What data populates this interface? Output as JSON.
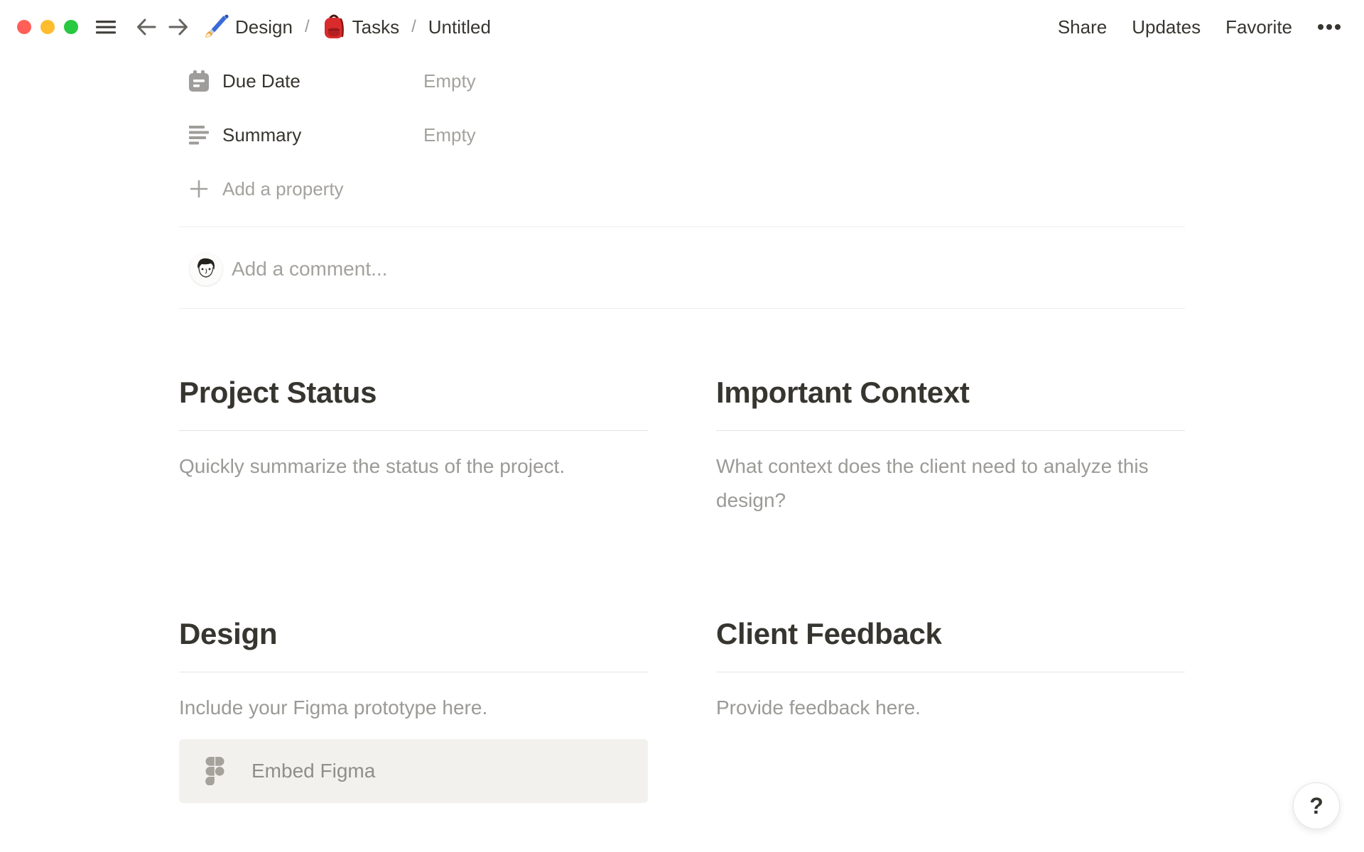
{
  "topbar": {
    "breadcrumb": [
      {
        "icon": "paintbrush-icon",
        "label": "Design"
      },
      {
        "icon": "backpack-icon",
        "label": "Tasks"
      },
      {
        "icon": null,
        "label": "Untitled"
      }
    ],
    "separator": "/",
    "actions": [
      "Share",
      "Updates",
      "Favorite"
    ],
    "more_icon": "ellipsis"
  },
  "properties": {
    "rows": [
      {
        "icon": "calendar-icon",
        "label": "Due Date",
        "value": "Empty"
      },
      {
        "icon": "text-lines-icon",
        "label": "Summary",
        "value": "Empty"
      }
    ],
    "add_property_label": "Add a property"
  },
  "comment": {
    "placeholder": "Add a comment...",
    "avatar": "user-sketch-avatar"
  },
  "sections": [
    {
      "title": "Project Status",
      "body": "Quickly summarize the status of the project."
    },
    {
      "title": "Important Context",
      "body": "What context does the client need to analyze this design?"
    },
    {
      "title": "Design",
      "body": "Include your Figma prototype here.",
      "embed_label": "Embed Figma",
      "embed_icon": "figma-icon"
    },
    {
      "title": "Client Feedback",
      "body": "Provide feedback here."
    }
  ],
  "help_button": {
    "label": "?"
  },
  "colors": {
    "text": "#37352f",
    "muted_text": "#9b9a97",
    "placeholder_text": "#a4a29e",
    "divider": "#e5e4e2",
    "embed_background": "#f2f1ee",
    "traffic_red": "#ff5f57",
    "traffic_yellow": "#febc2e",
    "traffic_green": "#28c840",
    "figma_icon_gray": "#a5a29c",
    "backpack_red": "#d92b2b",
    "paintbrush_blue": "#3a6bd8"
  }
}
